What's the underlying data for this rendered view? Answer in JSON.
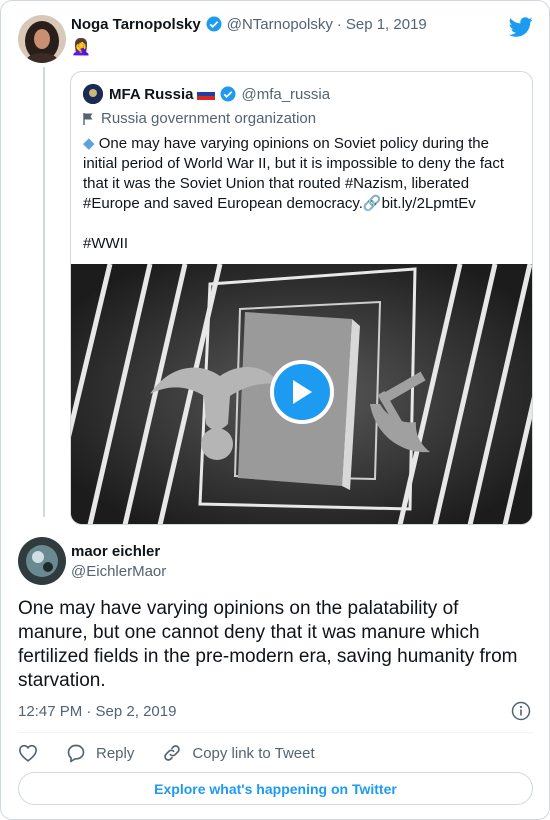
{
  "tweet": {
    "author_name": "Noga Tarnopolsky",
    "author_handle": "@NTarnopolsky",
    "date": "Sep 1, 2019",
    "emoji": "🤦‍♀️"
  },
  "quoted": {
    "author_name": "MFA Russia",
    "author_handle": "@mfa_russia",
    "label": "Russia government organization",
    "text_before": "One may have varying opinions on Soviet policy during the initial period of World War II, but it is impossible to deny the fact that it was the Soviet Union that routed #Nazism, liberated #Europe and saved European democracy.",
    "link": "bit.ly/2LpmtEv",
    "hashtag": "#WWII"
  },
  "reply": {
    "author_name": "maor eichler",
    "author_handle": "@EichlerMaor",
    "text": "One may have varying opinions on the palatability of manure, but one cannot deny that it was manure which fertilized fields in the pre-modern era, saving humanity from starvation.",
    "timestamp": "12:47 PM · Sep 2, 2019",
    "reply_label": "Reply",
    "copy_link_label": "Copy link to Tweet"
  },
  "explore_label": "Explore what's happening on Twitter",
  "colors": {
    "accent": "#1d9bf0",
    "border": "#cfd9de",
    "gray": "#536471"
  }
}
